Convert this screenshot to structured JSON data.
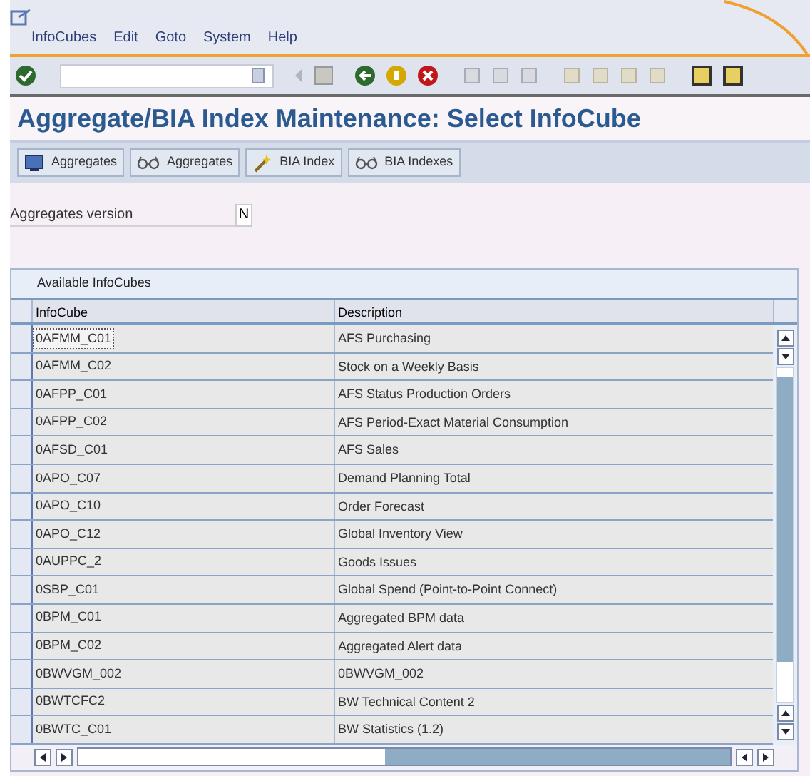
{
  "menu": [
    "InfoCubes",
    "Edit",
    "Goto",
    "System",
    "Help"
  ],
  "title": "Aggregate/BIA Index Maintenance: Select InfoCube",
  "app_toolbar": [
    {
      "label": "Aggregates",
      "kind": "monitor"
    },
    {
      "label": "Aggregates",
      "kind": "glasses"
    },
    {
      "label": "BIA Index",
      "kind": "wand"
    },
    {
      "label": "BIA Indexes",
      "kind": "glasses"
    }
  ],
  "aggregates_version": {
    "label": "Aggregates version",
    "value": "N"
  },
  "table": {
    "title": "Available InfoCubes",
    "columns": [
      "InfoCube",
      "Description"
    ],
    "rows": [
      {
        "infocube": "0AFMM_C01",
        "description": "AFS Purchasing",
        "focused": true
      },
      {
        "infocube": "0AFMM_C02",
        "description": "Stock on a Weekly Basis",
        "focused": false
      },
      {
        "infocube": "0AFPP_C01",
        "description": "AFS Status Production Orders",
        "focused": false
      },
      {
        "infocube": "0AFPP_C02",
        "description": "AFS Period-Exact Material Consumption",
        "focused": false
      },
      {
        "infocube": "0AFSD_C01",
        "description": "AFS Sales",
        "focused": false
      },
      {
        "infocube": "0APO_C07",
        "description": "Demand Planning Total",
        "focused": false
      },
      {
        "infocube": "0APO_C10",
        "description": "Order Forecast",
        "focused": false
      },
      {
        "infocube": "0APO_C12",
        "description": "Global Inventory View",
        "focused": false
      },
      {
        "infocube": "0AUPPC_2",
        "description": "Goods Issues",
        "focused": false
      },
      {
        "infocube": "0SBP_C01",
        "description": "Global Spend (Point-to-Point Connect)",
        "focused": false
      },
      {
        "infocube": "0BPM_C01",
        "description": "Aggregated BPM data",
        "focused": false
      },
      {
        "infocube": "0BPM_C02",
        "description": "Aggregated Alert data",
        "focused": false
      },
      {
        "infocube": "0BWVGM_002",
        "description": "0BWVGM_002",
        "focused": false
      },
      {
        "infocube": "0BWTCFC2",
        "description": "BW Technical Content 2",
        "focused": false
      },
      {
        "infocube": "0BWTC_C01",
        "description": "BW Statistics (1.2)",
        "focused": false
      }
    ]
  }
}
